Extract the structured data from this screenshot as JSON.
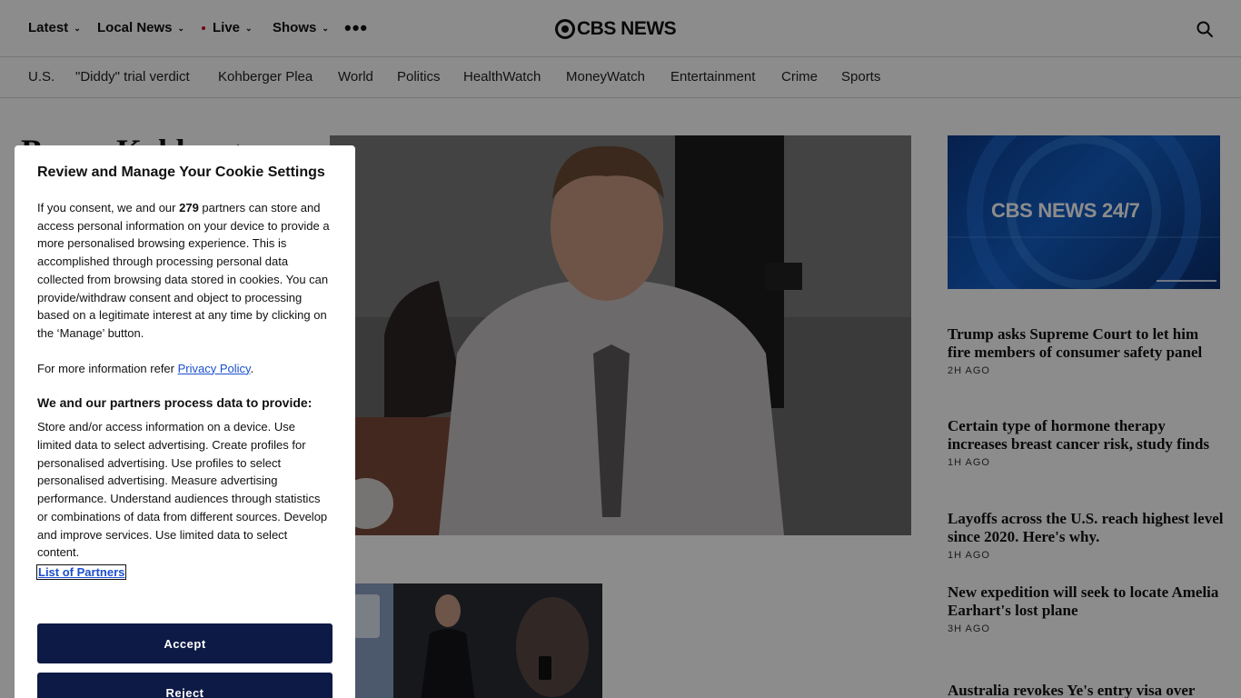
{
  "nav": {
    "items": [
      {
        "label": "Latest"
      },
      {
        "label": "Local News"
      },
      {
        "label": "Live"
      },
      {
        "label": "Shows"
      }
    ],
    "more": "•••",
    "logo_text": "CBS NEWS"
  },
  "subnav": {
    "items": [
      "U.S.",
      "\"Diddy\" trial verdict",
      "Kohberger Plea",
      "World",
      "Politics",
      "HealthWatch",
      "MoneyWatch",
      "Entertainment",
      "Crime",
      "Sports"
    ]
  },
  "main": {
    "headline_partial": "Bryan Kohberger"
  },
  "promo": {
    "title": "CBS NEWS 24/7"
  },
  "stories": [
    {
      "title": "Trump asks Supreme Court to let him fire members of consumer safety panel",
      "ago": "2H AGO"
    },
    {
      "title": "Certain type of hormone therapy increases breast cancer risk, study finds",
      "ago": "1H AGO"
    },
    {
      "title": "Layoffs across the U.S. reach highest level since 2020. Here's why.",
      "ago": "1H AGO"
    },
    {
      "title": "New expedition will seek to locate Amelia Earhart's lost plane",
      "ago": "3H AGO"
    },
    {
      "title": "Australia revokes Ye's entry visa over",
      "ago": ""
    }
  ],
  "cookie": {
    "title": "Review and Manage Your Cookie Settings",
    "intro_before": "If you consent, we and our ",
    "partner_count": "279",
    "intro_after": " partners can store and access personal information on your device to provide a more personalised browsing experience. This is accomplished through processing personal data collected from browsing data stored in cookies. You can provide/withdraw consent and object to processing based on a legitimate interest at any time by clicking on the ‘Manage’ button.",
    "more_info_before": "For more information refer ",
    "privacy_link": "Privacy Policy",
    "more_info_after": ".",
    "purposes_heading": "We and our partners process data to provide:",
    "purposes_text": "Store and/or access information on a device. Use limited data to select advertising. Create profiles for personalised advertising. Use profiles to select personalised advertising. Measure advertising performance. Understand audiences through statistics or combinations of data from different sources. Develop and improve services. Use limited data to select content.",
    "partners_link": "List of Partners",
    "accept_label": "Accept",
    "reject_label": "Reject"
  }
}
